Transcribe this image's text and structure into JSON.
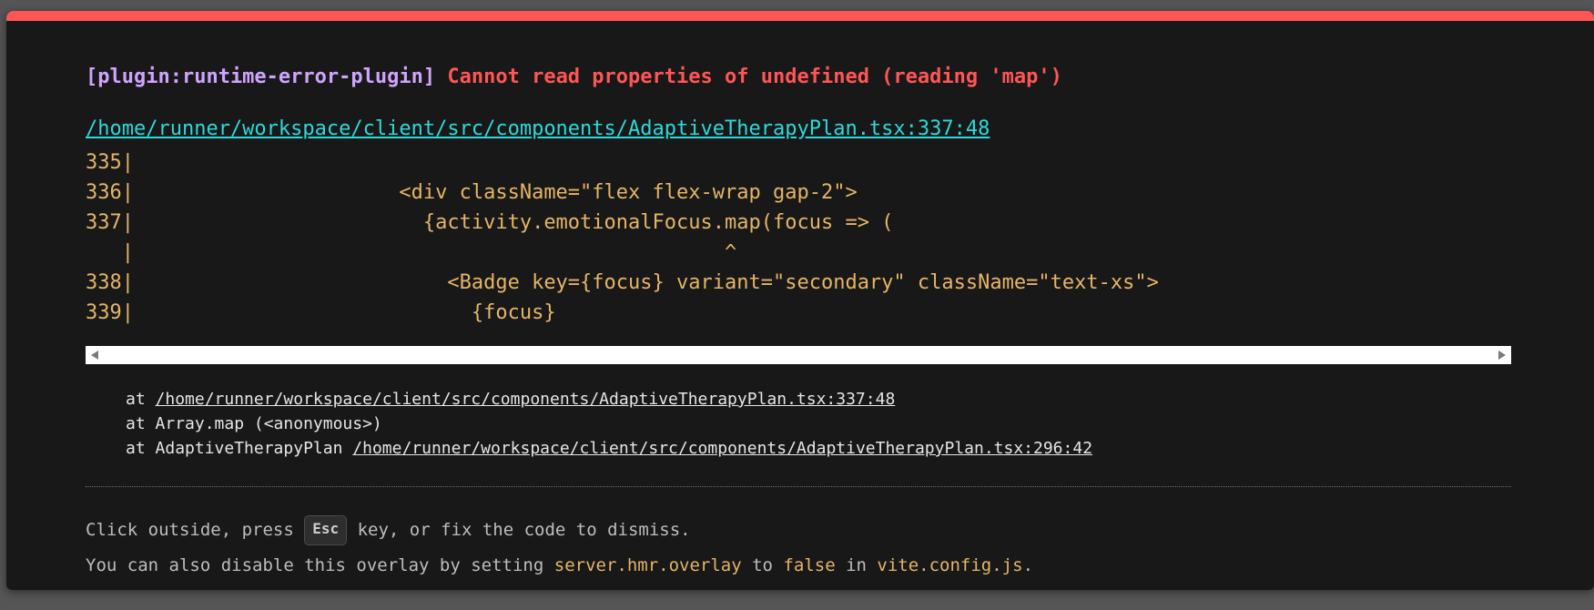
{
  "overlay": {
    "accent_color": "#ff5555",
    "plugin_label": "[plugin:runtime-error-plugin]",
    "message": "Cannot read properties of undefined (reading 'map')",
    "file": "/home/runner/workspace/client/src/components/AdaptiveTherapyPlan.tsx:337:48",
    "frame_lines": [
      "335|",
      "336|                      <div className=\"flex flex-wrap gap-2\">",
      "337|                        {activity.emotionalFocus.map(focus => (",
      "   |                                                 ^",
      "338|                          <Badge key={focus} variant=\"secondary\" className=\"text-xs\">",
      "339|                            {focus}"
    ],
    "stack": [
      {
        "prefix": "at ",
        "name": "",
        "link": "/home/runner/workspace/client/src/components/AdaptiveTherapyPlan.tsx:337:48"
      },
      {
        "prefix": "at ",
        "name": "Array.map (<anonymous>)",
        "link": ""
      },
      {
        "prefix": "at ",
        "name": "AdaptiveTherapyPlan ",
        "link": "/home/runner/workspace/client/src/components/AdaptiveTherapyPlan.tsx:296:42"
      }
    ],
    "tip": {
      "line1_before": "Click outside, press ",
      "kbd": "Esc",
      "line1_after": " key, or fix the code to dismiss.",
      "line2_a": "You can also disable this overlay by setting ",
      "line2_code1": "server.hmr.overlay",
      "line2_b": " to ",
      "line2_code2": "false",
      "line2_c": " in ",
      "line2_code3": "vite.config.js",
      "line2_d": "."
    }
  }
}
